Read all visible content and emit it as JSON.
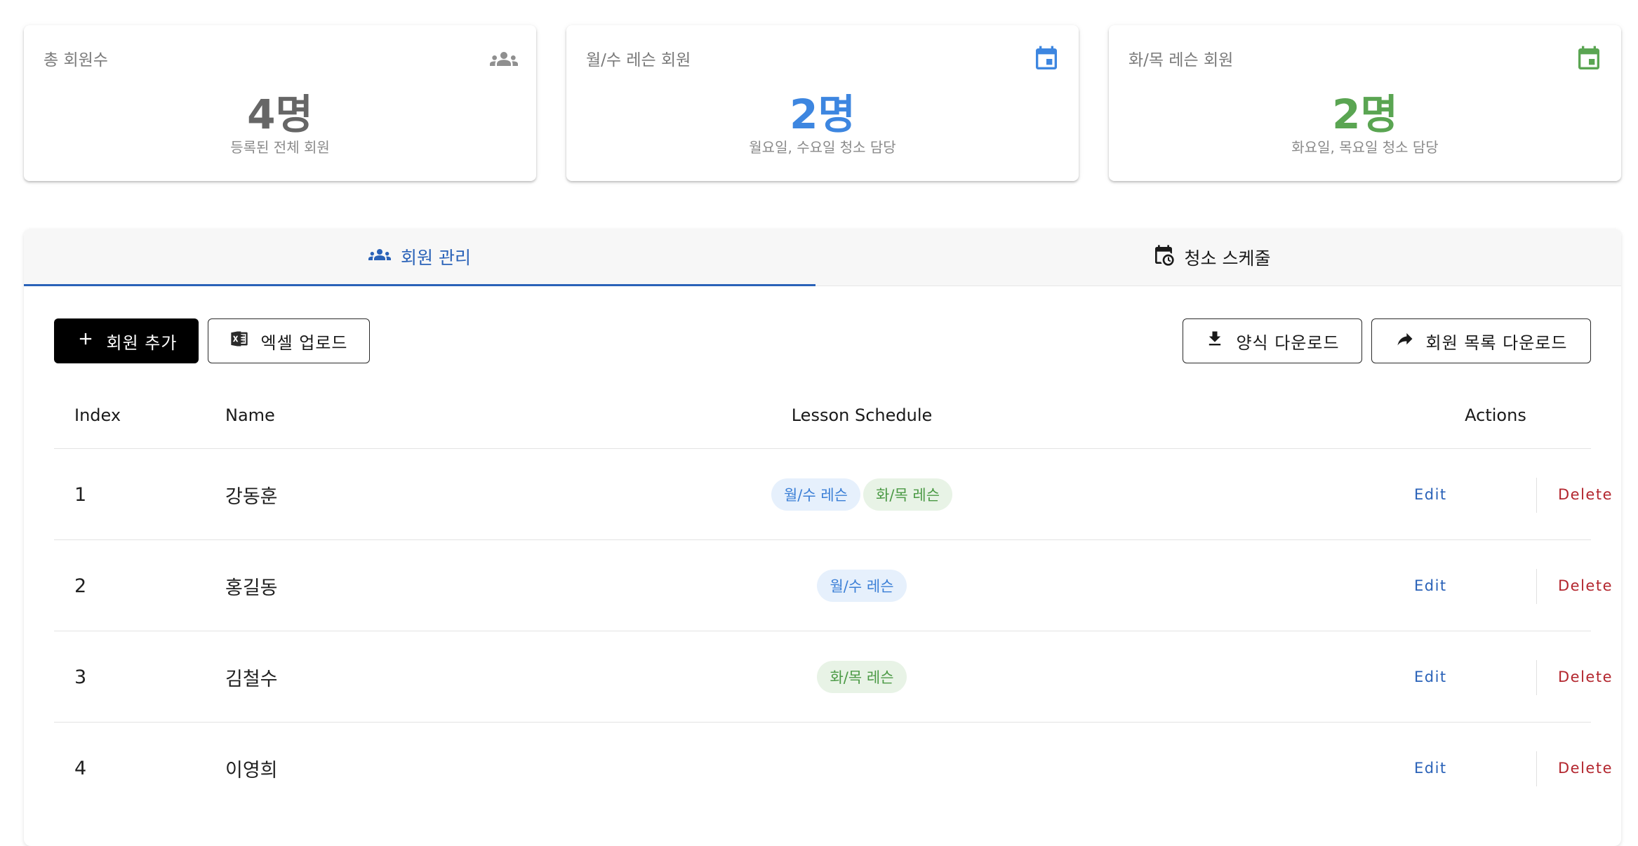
{
  "stats": {
    "total": {
      "title": "총 회원수",
      "value": "4명",
      "subtitle": "등록된 전체 회원",
      "icon": "people-icon",
      "color": "#666666"
    },
    "monwed": {
      "title": "월/수 레슨 회원",
      "value": "2명",
      "subtitle": "월요일, 수요일 청소 담당",
      "icon": "calendar-icon",
      "color": "#3d86e0"
    },
    "tuethu": {
      "title": "화/목 레슨 회원",
      "value": "2명",
      "subtitle": "화요일, 목요일 청소 담당",
      "icon": "calendar-icon",
      "color": "#5aa552"
    }
  },
  "tabs": [
    {
      "label": "회원 관리",
      "icon": "people-icon",
      "active": true
    },
    {
      "label": "청소 스케줄",
      "icon": "calendar-clock-icon",
      "active": false
    }
  ],
  "toolbar": {
    "add_member": "회원 추가",
    "excel_upload": "엑셀 업로드",
    "template_download": "양식 다운로드",
    "member_list_download": "회원 목록 다운로드"
  },
  "table": {
    "headers": {
      "index": "Index",
      "name": "Name",
      "schedule": "Lesson Schedule",
      "actions": "Actions"
    },
    "rows": [
      {
        "index": "1",
        "name": "강동훈",
        "chips": [
          "월/수 레슨",
          "화/목 레슨"
        ]
      },
      {
        "index": "2",
        "name": "홍길동",
        "chips": [
          "월/수 레슨"
        ]
      },
      {
        "index": "3",
        "name": "김철수",
        "chips": [
          "화/목 레슨"
        ]
      },
      {
        "index": "4",
        "name": "이영희",
        "chips": []
      }
    ],
    "edit_label": "Edit",
    "delete_label": "Delete"
  },
  "colors": {
    "accent": "#2a62b8",
    "monwed": "#3d86e0",
    "tuethu": "#5aa552",
    "delete": "#b3262e"
  }
}
